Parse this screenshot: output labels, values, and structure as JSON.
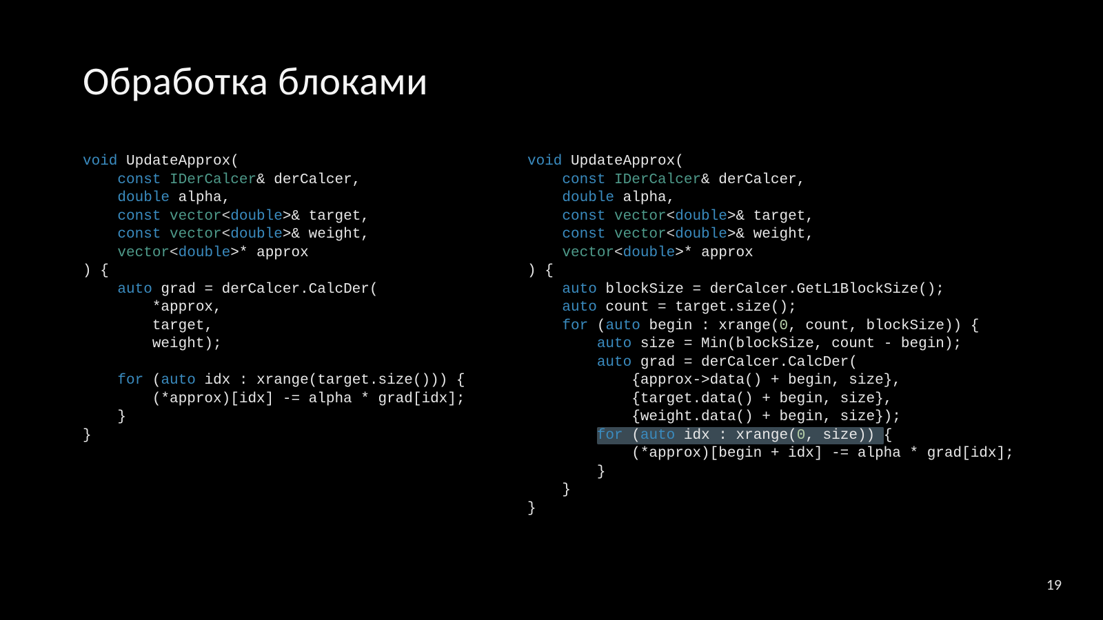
{
  "title": "Обработка блоками",
  "page_number": "19",
  "left": {
    "l1a": "void",
    "l1b": " UpdateApprox(",
    "l2a": "    const",
    "l2b": " IDerCalcer",
    "l2c": "& derCalcer,",
    "l3a": "    double",
    "l3b": " alpha,",
    "l4a": "    const",
    "l4b": " vector",
    "l4c": "<",
    "l4d": "double",
    "l4e": ">& target,",
    "l5a": "    const",
    "l5b": " vector",
    "l5c": "<",
    "l5d": "double",
    "l5e": ">& weight,",
    "l6a": "    ",
    "l6b": "vector",
    "l6c": "<",
    "l6d": "double",
    "l6e": ">* approx",
    "l7": ") {",
    "l8a": "    auto",
    "l8b": " grad = derCalcer.CalcDer(",
    "l9": "        *approx,",
    "l10": "        target,",
    "l11": "        weight);",
    "l12": "",
    "l13a": "    for",
    "l13b": " (",
    "l13c": "auto",
    "l13d": " idx : xrange(target.size())) {",
    "l14": "        (*approx)[idx] -= alpha * grad[idx];",
    "l15": "    }",
    "l16": "}"
  },
  "right": {
    "l1a": "void",
    "l1b": " UpdateApprox(",
    "l2a": "    const",
    "l2b": " IDerCalcer",
    "l2c": "& derCalcer,",
    "l3a": "    double",
    "l3b": " alpha,",
    "l4a": "    const",
    "l4b": " vector",
    "l4c": "<",
    "l4d": "double",
    "l4e": ">& target,",
    "l5a": "    const",
    "l5b": " vector",
    "l5c": "<",
    "l5d": "double",
    "l5e": ">& weight,",
    "l6a": "    ",
    "l6b": "vector",
    "l6c": "<",
    "l6d": "double",
    "l6e": ">* approx",
    "l7": ") {",
    "l8a": "    auto",
    "l8b": " blockSize = derCalcer.GetL1BlockSize();",
    "l9a": "    auto",
    "l9b": " count = target.size();",
    "l10a": "    for",
    "l10b": " (",
    "l10c": "auto",
    "l10d": " begin : xrange(",
    "l10e": "0",
    "l10f": ", count, blockSize)) {",
    "l11a": "        auto",
    "l11b": " size = Min(blockSize, count - begin);",
    "l12a": "        auto",
    "l12b": " grad = derCalcer.CalcDer(",
    "l13": "            {approx->data() + begin, size},",
    "l14": "            {target.data() + begin, size},",
    "l15": "            {weight.data() + begin, size});",
    "l16a": "        ",
    "l16b": "for",
    "l16c": " (",
    "l16d": "auto",
    "l16e": " idx : xrange(",
    "l16f": "0",
    "l16g": ", size)) ",
    "l16h": "{",
    "l17": "            (*approx)[begin + idx] -= alpha * grad[idx];",
    "l18": "        }",
    "l19": "    }",
    "l20": "}"
  }
}
